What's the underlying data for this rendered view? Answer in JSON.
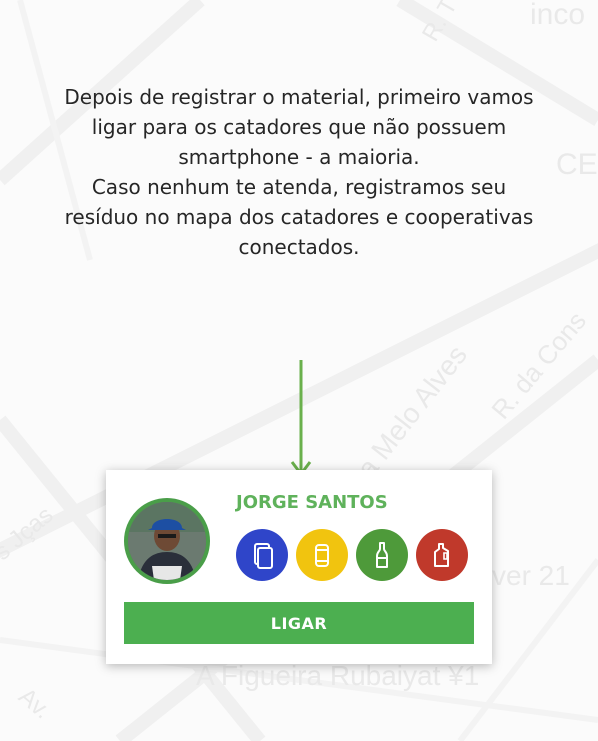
{
  "map": {
    "labels": [
      "inco",
      "R. T",
      "CE",
      "Rua Melo Alves",
      "R. da Cons",
      "s Jças",
      "ver 21",
      "A Figueira Rubaiyat ¥1",
      "Av."
    ]
  },
  "instruction": {
    "paragraph_1": "Depois de registrar o material, primeiro vamos ligar para os catadores que não possuem smartphone - a maioria.",
    "paragraph_2": "Caso nenhum te atenda, registramos seu resíduo no mapa dos catadores e cooperativas conectados."
  },
  "collector": {
    "name": "JORGE SANTOS",
    "materials": [
      {
        "type": "paper",
        "icon": "paper-icon",
        "color": "#2f45c9"
      },
      {
        "type": "metal",
        "icon": "can-icon",
        "color": "#f1c40f"
      },
      {
        "type": "glass",
        "icon": "bottle-icon",
        "color": "#4e9a3a"
      },
      {
        "type": "plastic",
        "icon": "jug-icon",
        "color": "#c0392b"
      }
    ],
    "call_label": "LIGAR"
  },
  "colors": {
    "accent_green": "#4caf50",
    "name_green": "#5fb25b",
    "arrow_green": "#6ab04c"
  }
}
